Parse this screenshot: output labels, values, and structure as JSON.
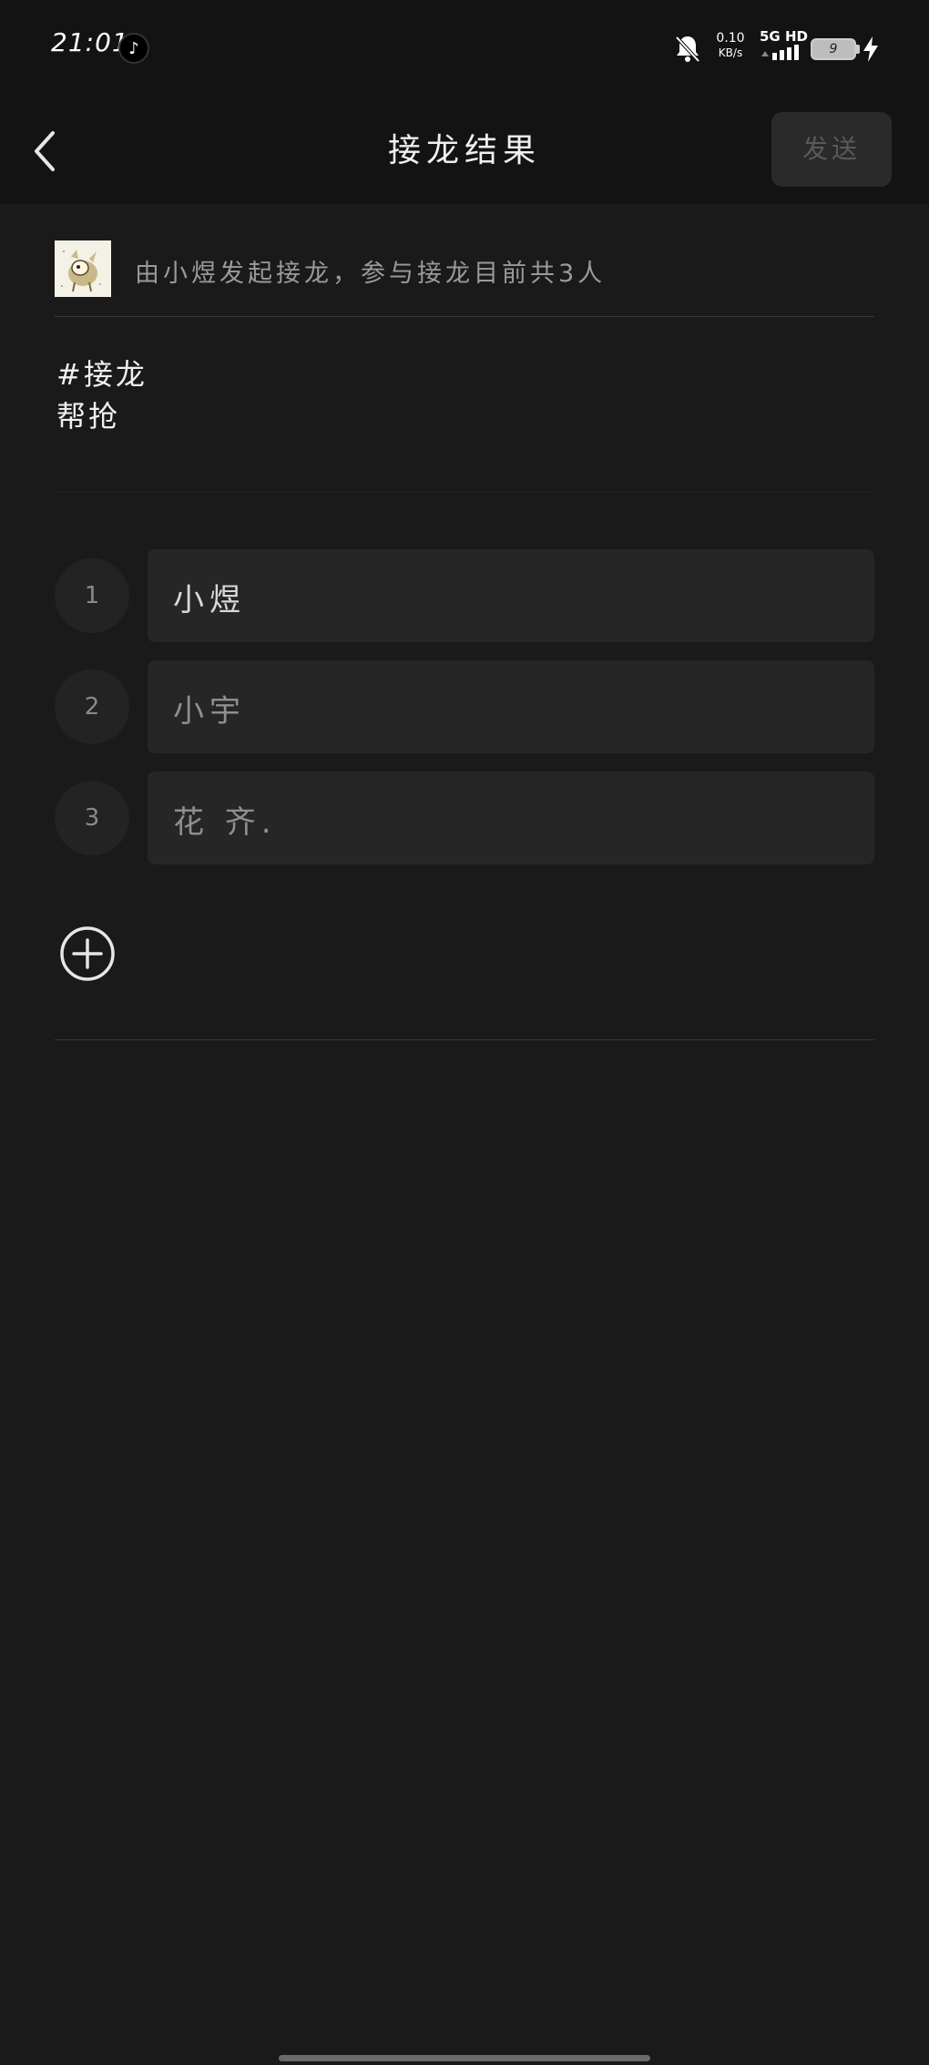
{
  "status_bar": {
    "time": "21:01",
    "app_icon": "tiktok-icon",
    "net_speed_value": "0.10",
    "net_speed_unit": "KB/s",
    "network_label": "5G HD",
    "battery_level": "9"
  },
  "header": {
    "title": "接龙结果",
    "send_label": "发送"
  },
  "origin": {
    "text": "由小煜发起接龙，参与接龙目前共3人"
  },
  "description": {
    "line1": "#接龙",
    "line2": "帮抢"
  },
  "entries": [
    {
      "index": "1",
      "name": "小煜"
    },
    {
      "index": "2",
      "name": "小宇"
    },
    {
      "index": "3",
      "name": "花 齐."
    }
  ],
  "icons": {
    "back": "chevron-left-icon",
    "add": "plus-circle-icon",
    "mute": "bell-off-icon",
    "charging": "bolt-icon"
  },
  "colors": {
    "background": "#1a1a1a",
    "header_bg": "#131313",
    "entry_bg": "#262626",
    "send_disabled": "#2a2a2a"
  }
}
